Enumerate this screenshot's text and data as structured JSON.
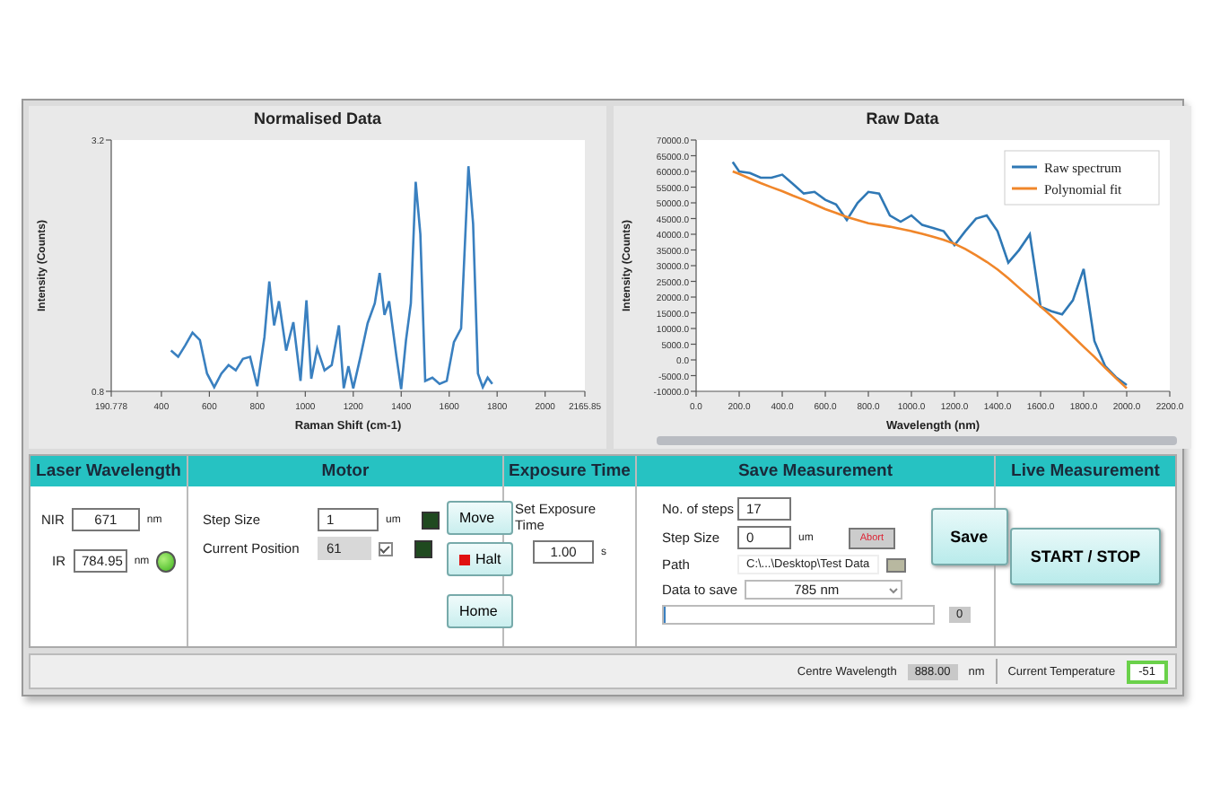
{
  "charts": [
    {
      "title": "Normalised Data",
      "chart_data": {
        "type": "line",
        "xlabel": "Raman Shift (cm-1)",
        "ylabel": "Intensity (Counts)",
        "x": [
          440,
          470,
          500,
          530,
          560,
          590,
          620,
          650,
          680,
          710,
          740,
          770,
          800,
          830,
          850,
          870,
          890,
          920,
          950,
          980,
          1005,
          1025,
          1050,
          1080,
          1110,
          1140,
          1160,
          1180,
          1200,
          1230,
          1260,
          1290,
          1310,
          1330,
          1350,
          1380,
          1400,
          1420,
          1440,
          1460,
          1480,
          1500,
          1530,
          1560,
          1590,
          1620,
          1650,
          1680,
          1700,
          1720,
          1740,
          1760,
          1780
        ],
        "series": [
          {
            "color": "#3a80c0",
            "values": [
              1.19,
              1.13,
              1.24,
              1.36,
              1.29,
              0.97,
              0.84,
              0.97,
              1.05,
              1.0,
              1.11,
              1.13,
              0.85,
              1.32,
              1.85,
              1.43,
              1.66,
              1.19,
              1.46,
              0.9,
              1.67,
              0.92,
              1.21,
              1.0,
              1.05,
              1.43,
              0.83,
              1.04,
              0.83,
              1.13,
              1.45,
              1.64,
              1.93,
              1.53,
              1.66,
              1.13,
              0.82,
              1.29,
              1.64,
              2.8,
              2.3,
              0.9,
              0.93,
              0.87,
              0.9,
              1.27,
              1.4,
              2.95,
              2.4,
              0.97,
              0.84,
              0.93,
              0.87
            ]
          }
        ],
        "xlim": [
          190.778,
          2165.85
        ],
        "ylim": [
          0.8,
          3.2
        ],
        "xticks": [
          {
            "value": 190.778,
            "label": "190.778"
          },
          400,
          600,
          800,
          1000,
          1200,
          1400,
          1600,
          1800,
          2000,
          {
            "value": 2165.85,
            "label": "2165.85"
          }
        ],
        "yticks": [
          0.8,
          3.2
        ]
      }
    },
    {
      "title": "Raw Data",
      "chart_data": {
        "type": "line",
        "xlabel": "Wavelength (nm)",
        "ylabel": "Intensity (Counts)",
        "x": [
          170,
          200,
          250,
          300,
          350,
          400,
          450,
          500,
          550,
          600,
          650,
          700,
          750,
          800,
          850,
          900,
          950,
          1000,
          1050,
          1100,
          1150,
          1200,
          1250,
          1300,
          1350,
          1400,
          1450,
          1500,
          1550,
          1600,
          1650,
          1700,
          1750,
          1800,
          1850,
          1900,
          1950,
          2000
        ],
        "series": [
          {
            "name": "Raw spectrum",
            "color": "#2f78b5",
            "values": [
              63000,
              60000,
              59500,
              58000,
              58000,
              59000,
              56000,
              53000,
              53500,
              51000,
              49500,
              44500,
              50000,
              53500,
              53000,
              46000,
              44000,
              46000,
              43000,
              42000,
              41000,
              36500,
              41000,
              45000,
              46000,
              41000,
              31000,
              35000,
              40000,
              17000,
              15500,
              14500,
              19000,
              29000,
              6000,
              -2000,
              -5500,
              -8000
            ]
          },
          {
            "name": "Polynomial fit",
            "color": "#f0862a",
            "values": [
              60000,
              59200,
              57700,
              56300,
              55000,
              53700,
              52300,
              51000,
              49500,
              48000,
              46800,
              45500,
              44500,
              43500,
              43000,
              42400,
              41700,
              41000,
              40200,
              39200,
              38200,
              37000,
              35300,
              33300,
              31200,
              28800,
              26000,
              23000,
              20000,
              17000,
              14000,
              10800,
              7500,
              4200,
              1000,
              -2500,
              -5800,
              -9000
            ]
          }
        ],
        "legend": "upper right",
        "xlim": [
          0,
          2200
        ],
        "ylim": [
          -10000,
          70000
        ],
        "xticks": [
          {
            "value": 0,
            "label": "0.0"
          },
          {
            "value": 200,
            "label": "200.0"
          },
          {
            "value": 400,
            "label": "400.0"
          },
          {
            "value": 600,
            "label": "600.0"
          },
          {
            "value": 800,
            "label": "800.0"
          },
          {
            "value": 1000,
            "label": "1000.0"
          },
          {
            "value": 1200,
            "label": "1200.0"
          },
          {
            "value": 1400,
            "label": "1400.0"
          },
          {
            "value": 1600,
            "label": "1600.0"
          },
          {
            "value": 1800,
            "label": "1800.0"
          },
          {
            "value": 2000,
            "label": "2000.0"
          },
          {
            "value": 2200,
            "label": "2200.0"
          }
        ],
        "yticks": [
          {
            "value": -10000,
            "label": "-10000.0"
          },
          {
            "value": -5000,
            "label": "-5000.0"
          },
          {
            "value": 0,
            "label": "0.0"
          },
          {
            "value": 5000,
            "label": "5000.0"
          },
          {
            "value": 10000,
            "label": "10000.0"
          },
          {
            "value": 15000,
            "label": "15000.0"
          },
          {
            "value": 20000,
            "label": "20000.0"
          },
          {
            "value": 25000,
            "label": "25000.0"
          },
          {
            "value": 30000,
            "label": "30000.0"
          },
          {
            "value": 35000,
            "label": "35000.0"
          },
          {
            "value": 40000,
            "label": "40000.0"
          },
          {
            "value": 45000,
            "label": "45000.0"
          },
          {
            "value": 50000,
            "label": "50000.0"
          },
          {
            "value": 55000,
            "label": "55000.0"
          },
          {
            "value": 60000,
            "label": "60000.0"
          },
          {
            "value": 65000,
            "label": "65000.0"
          },
          {
            "value": 70000,
            "label": "70000.0"
          }
        ]
      }
    }
  ],
  "laser": {
    "title": "Laser Wavelength",
    "nir": {
      "label": "NIR",
      "value": "671",
      "unit": "nm"
    },
    "ir": {
      "label": "IR",
      "value": "784.95",
      "unit": "nm"
    },
    "indicator_on": true
  },
  "motor": {
    "title": "Motor",
    "step_size": {
      "label": "Step Size",
      "value": "1",
      "unit": "um",
      "led_on": false
    },
    "current_position": {
      "label": "Current Position",
      "value": "61",
      "checked": true,
      "led_on": false
    },
    "move": "Move",
    "halt": "Halt",
    "home": "Home"
  },
  "exposure": {
    "title": "Exposure Time",
    "label": "Set Exposure Time",
    "value": "1.00",
    "unit": "s"
  },
  "save": {
    "title": "Save Measurement",
    "steps": {
      "label": "No. of steps",
      "value": "17"
    },
    "step_size": {
      "label": "Step Size",
      "value": "0",
      "unit": "um"
    },
    "abort": "Abort",
    "path": {
      "label": "Path",
      "value": "C:\\...\\Desktop\\Test Data"
    },
    "data_to_save": {
      "label": "Data to save",
      "value": "785 nm"
    },
    "progress": {
      "level": 0,
      "value": "0"
    },
    "save_button": "Save"
  },
  "live": {
    "title": "Live Measurement",
    "button": "START / STOP"
  },
  "status_bar": {
    "centre_wavelength": {
      "label": "Centre Wavelength",
      "value": "888.00",
      "unit": "nm"
    },
    "current_temperature": {
      "label": "Current Temperature",
      "value": "-51"
    }
  }
}
